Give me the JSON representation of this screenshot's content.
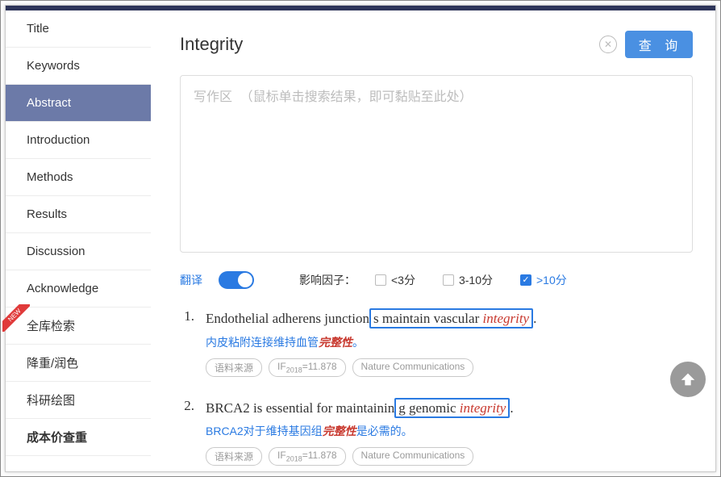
{
  "sidebar": {
    "items": [
      {
        "label": "Title",
        "active": false
      },
      {
        "label": "Keywords",
        "active": false
      },
      {
        "label": "Abstract",
        "active": true
      },
      {
        "label": "Introduction",
        "active": false
      },
      {
        "label": "Methods",
        "active": false
      },
      {
        "label": "Results",
        "active": false
      },
      {
        "label": "Discussion",
        "active": false
      },
      {
        "label": "Acknowledge",
        "active": false
      },
      {
        "label": "全库检索",
        "active": false,
        "new": true
      },
      {
        "label": "降重/润色",
        "active": false
      },
      {
        "label": "科研绘图",
        "active": false
      },
      {
        "label": "成本价查重",
        "active": false,
        "bold": true
      }
    ],
    "new_badge": "NEW"
  },
  "search": {
    "value": "Integrity",
    "query_label": "查 询"
  },
  "writing_placeholder": "写作区 （鼠标单击搜索结果，即可黏贴至此处）",
  "filters": {
    "translate_label": "翻译",
    "translate_on": true,
    "impact_label": "影响因子：",
    "opts": [
      {
        "label": "<3分",
        "checked": false
      },
      {
        "label": "3-10分",
        "checked": false
      },
      {
        "label": ">10分",
        "checked": true
      }
    ]
  },
  "results": [
    {
      "num": "1.",
      "en_pre": "Endothelial adherens junction",
      "en_box": "s maintain vascular ",
      "en_kw": "integrity",
      "en_post": ".",
      "cn_pre": "内皮粘附连接维持血管",
      "cn_kw": "完整性",
      "cn_post": "。",
      "tags": [
        "语料来源",
        "IF 2018 =11.878",
        "Nature Communications"
      ]
    },
    {
      "num": "2.",
      "en_pre": "BRCA2 is essential for maintainin",
      "en_box": "g genomic ",
      "en_kw": "integrity",
      "en_post": ".",
      "cn_pre": "BRCA2对于维持基因组",
      "cn_kw": "完整性",
      "cn_post": "是必需的。",
      "tags": [
        "语料来源",
        "IF 2018 =11.878",
        "Nature Communications"
      ]
    }
  ]
}
